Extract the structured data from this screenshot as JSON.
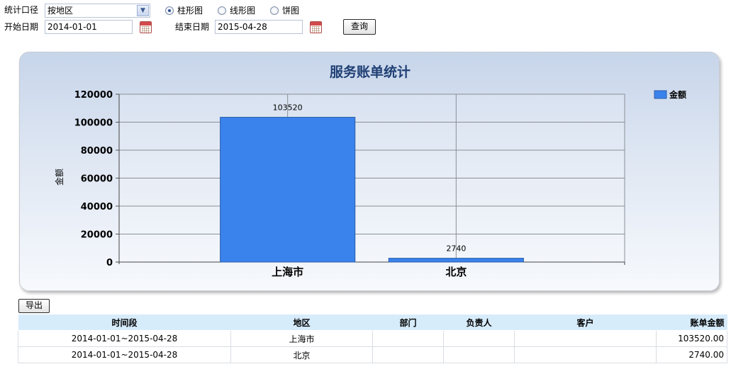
{
  "filters": {
    "scope_label": "统计口径",
    "scope_value": "按地区",
    "chart_types": [
      {
        "label": "柱形图",
        "selected": true
      },
      {
        "label": "线形图",
        "selected": false
      },
      {
        "label": "饼图",
        "selected": false
      }
    ],
    "start_label": "开始日期",
    "start_value": "2014-01-01",
    "end_label": "结束日期",
    "end_value": "2015-04-28",
    "query_label": "查询"
  },
  "chart_data": {
    "type": "bar",
    "title": "服务账单统计",
    "categories": [
      "上海市",
      "北京"
    ],
    "series": [
      {
        "name": "金额",
        "values": [
          103520,
          2740
        ],
        "color": "#3a82ec"
      }
    ],
    "xlabel": "",
    "ylabel": "金额",
    "ylim": [
      0,
      120000
    ],
    "yticks": [
      0,
      20000,
      40000,
      60000,
      80000,
      100000,
      120000
    ],
    "data_labels": [
      "103520",
      "2740"
    ],
    "grid": true,
    "legend_position": "top-right"
  },
  "export_label": "导出",
  "table": {
    "columns": [
      "时间段",
      "地区",
      "部门",
      "负责人",
      "客户",
      "账单金额"
    ],
    "rows": [
      [
        "2014-01-01~2015-04-28",
        "上海市",
        "",
        "",
        "",
        "103520.00"
      ],
      [
        "2014-01-01~2015-04-28",
        "北京",
        "",
        "",
        "",
        "2740.00"
      ]
    ]
  }
}
